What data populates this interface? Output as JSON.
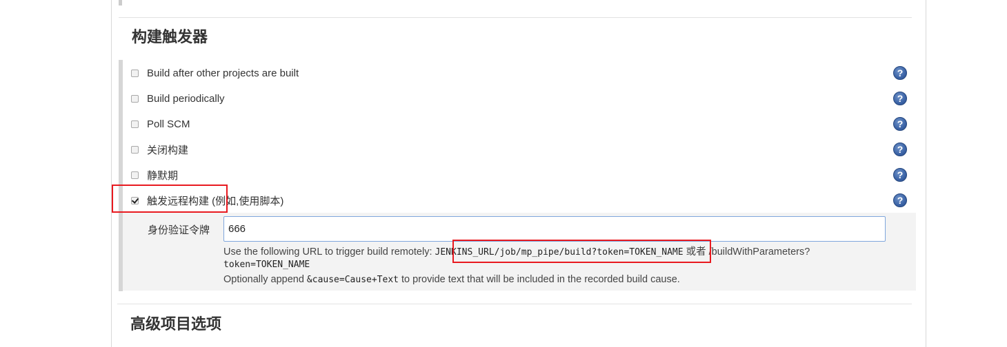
{
  "build_triggers": {
    "title": "构建触发器",
    "options": [
      {
        "label": "Build after other projects are built",
        "checked": false
      },
      {
        "label": "Build periodically",
        "checked": false
      },
      {
        "label": "Poll SCM",
        "checked": false
      },
      {
        "label": "关闭构建",
        "checked": false
      },
      {
        "label": "静默期",
        "checked": false
      },
      {
        "label": "触发远程构建 (例如,使用脚本)",
        "checked": true
      }
    ],
    "help_icon": "?",
    "remote": {
      "token_label": "身份验证令牌",
      "token_value": "666",
      "desc_prefix": "Use the following URL to trigger build remotely: ",
      "desc_url": "JENKINS_URL/job/mp_pipe/build?token=TOKEN_NAME",
      "desc_or": " 或者 /buildWithParameters?",
      "desc_token_line": "token=TOKEN_NAME",
      "desc_append_prefix": "Optionally append ",
      "desc_append_code": "&cause=Cause+Text",
      "desc_append_suffix": " to provide text that will be included in the recorded build cause."
    }
  },
  "advanced": {
    "title": "高级项目选项"
  },
  "annotation_color": "#e8191f",
  "help_icon_name": "question-circle-icon"
}
